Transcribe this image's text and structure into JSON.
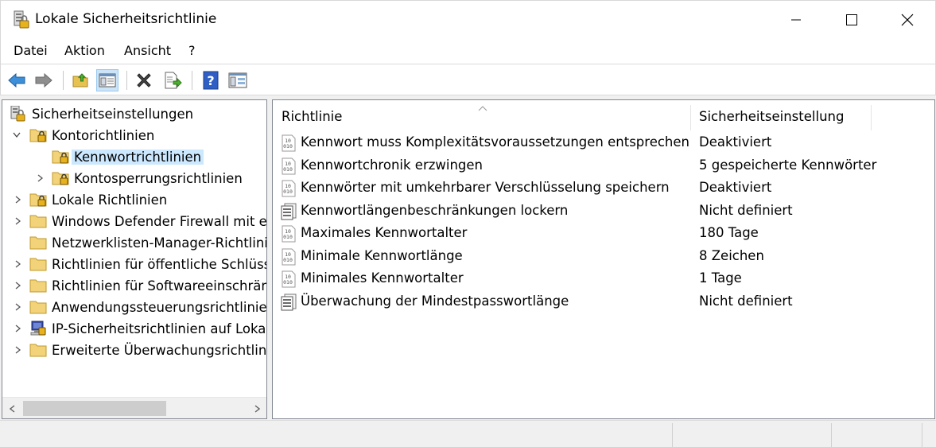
{
  "window": {
    "title": "Lokale Sicherheitsrichtlinie",
    "icon": "security-policy-icon",
    "controls": [
      "minimize-icon",
      "maximize-icon",
      "close-icon"
    ]
  },
  "menu": {
    "items": [
      "Datei",
      "Aktion",
      "Ansicht",
      "?"
    ]
  },
  "toolbar": {
    "buttons": [
      "back-arrow-icon",
      "forward-arrow-icon",
      "up-folder-icon",
      "show-hide-tree-icon",
      "delete-icon",
      "export-list-icon",
      "help-icon",
      "properties-icon"
    ]
  },
  "tree": {
    "root": "Sicherheitseinstellungen",
    "items": [
      {
        "label": "Kontorichtlinien",
        "expanded": true
      },
      {
        "label": "Kennwortrichtlinien",
        "selected": true
      },
      {
        "label": "Kontosperrungsrichtlinien"
      },
      {
        "label": "Lokale Richtlinien"
      },
      {
        "label": "Windows Defender Firewall mit erweiterter Sicherheit"
      },
      {
        "label": "Netzwerklisten-Manager-Richtlinien"
      },
      {
        "label": "Richtlinien für öffentliche Schlüssel"
      },
      {
        "label": "Richtlinien für Softwareeinschränkung"
      },
      {
        "label": "Anwendungssteuerungsrichtlinien"
      },
      {
        "label": "IP-Sicherheitsrichtlinien auf Lokaler Computer"
      },
      {
        "label": "Erweiterte Überwachungsrichtlinienkonfiguration"
      }
    ]
  },
  "list": {
    "columns": [
      "Richtlinie",
      "Sicherheitseinstellung"
    ],
    "rows": [
      {
        "policy": "Kennwort muss Komplexitätsvoraussetzungen entsprechen",
        "setting": "Deaktiviert",
        "icon": "binary-policy-icon"
      },
      {
        "policy": "Kennwortchronik erzwingen",
        "setting": "5 gespeicherte Kennwörter",
        "icon": "binary-policy-icon"
      },
      {
        "policy": "Kennwörter mit umkehrbarer Verschlüsselung speichern",
        "setting": "Deaktiviert",
        "icon": "binary-policy-icon"
      },
      {
        "policy": "Kennwortlängenbeschränkungen lockern",
        "setting": "Nicht definiert",
        "icon": "document-policy-icon"
      },
      {
        "policy": "Maximales Kennwortalter",
        "setting": "180 Tage",
        "icon": "binary-policy-icon"
      },
      {
        "policy": "Minimale Kennwortlänge",
        "setting": "8 Zeichen",
        "icon": "binary-policy-icon"
      },
      {
        "policy": "Minimales Kennwortalter",
        "setting": "1 Tage",
        "icon": "binary-policy-icon"
      },
      {
        "policy": "Überwachung der Mindestpasswortlänge",
        "setting": "Nicht definiert",
        "icon": "document-policy-icon"
      }
    ]
  }
}
